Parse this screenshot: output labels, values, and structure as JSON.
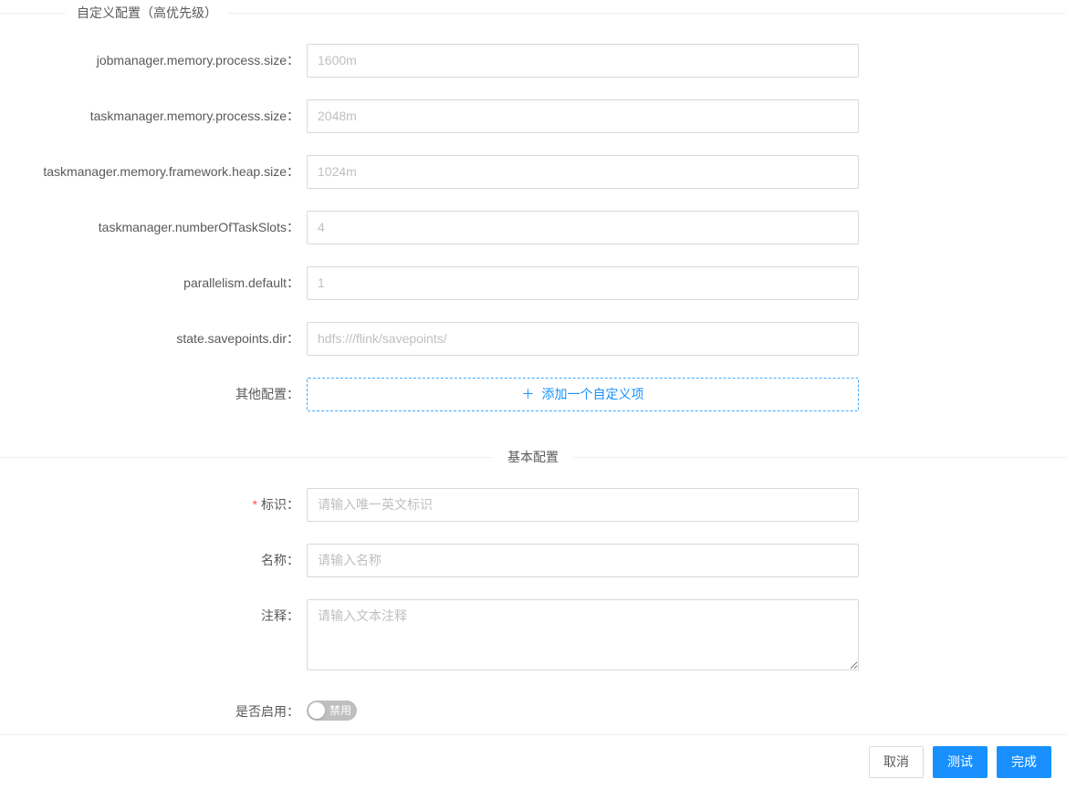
{
  "sections": {
    "custom": "自定义配置（高优先级）",
    "basic": "基本配置"
  },
  "custom": {
    "jobmanager_label": "jobmanager.memory.process.size",
    "jobmanager_placeholder": "1600m",
    "taskmanager_mem_label": "taskmanager.memory.process.size",
    "taskmanager_mem_placeholder": "2048m",
    "taskmanager_heap_label": "taskmanager.memory.framework.heap.size",
    "taskmanager_heap_placeholder": "1024m",
    "slots_label": "taskmanager.numberOfTaskSlots",
    "slots_placeholder": "4",
    "parallelism_label": "parallelism.default",
    "parallelism_placeholder": "1",
    "savepoints_label": "state.savepoints.dir",
    "savepoints_placeholder": "hdfs:///flink/savepoints/",
    "other_label": "其他配置",
    "add_button": "添加一个自定义项"
  },
  "basic": {
    "id_label": "标识",
    "id_placeholder": "请输入唯一英文标识",
    "name_label": "名称",
    "name_placeholder": "请输入名称",
    "note_label": "注释",
    "note_placeholder": "请输入文本注释",
    "enable_label": "是否启用",
    "switch_text": "禁用"
  },
  "footer": {
    "cancel": "取消",
    "test": "测试",
    "finish": "完成"
  }
}
